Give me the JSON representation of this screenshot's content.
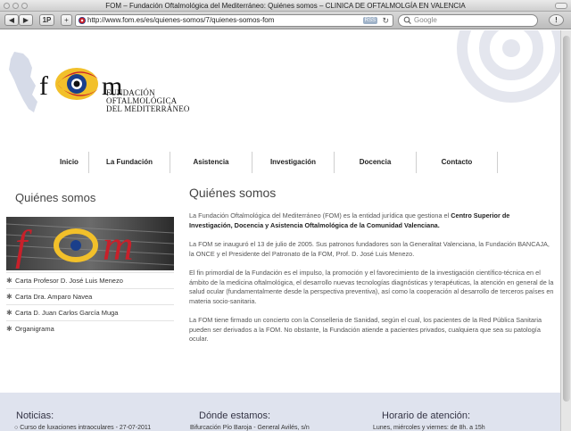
{
  "browser": {
    "window_title": "FOM – Fundación Oftalmológica del Mediterráneo: Quiénes somos – CLINICA DE OFTALMOLGÍA EN VALENCIA",
    "url": "http://www.fom.es/es/quienes-somos/7/quienes-somos-fom",
    "rss_label": "RSS",
    "search_placeholder": "Google",
    "back_label": "◀",
    "forward_label": "▶",
    "one_p_label": "1P",
    "add_label": "+",
    "reload_label": "↻",
    "info_label": "!"
  },
  "logo": {
    "line1": "FUNDACIÓN",
    "line2": "OFTALMOLÓGICA",
    "line3": "DEL MEDITERRÁNEO"
  },
  "nav": [
    {
      "label": "Inicio"
    },
    {
      "label": "La Fundación"
    },
    {
      "label": "Asistencia"
    },
    {
      "label": "Investigación"
    },
    {
      "label": "Docencia"
    },
    {
      "label": "Contacto"
    }
  ],
  "sidebar": {
    "title": "Quiénes somos",
    "items": [
      {
        "label": "Carta Profesor D. José Luis Menezo"
      },
      {
        "label": "Carta Dra. Amparo Navea"
      },
      {
        "label": "Carta D. Juan Carlos García Muga"
      },
      {
        "label": "Organigrama"
      }
    ]
  },
  "main": {
    "title": "Quiénes somos",
    "p1_prefix": "La Fundación Oftalmológica del Mediterráneo (FOM) es la entidad jurídica que gestiona el ",
    "p1_bold": "Centro Superior de Investigación, Docencia y Asistencia Oftalmológica de la Comunidad Valenciana.",
    "p2": "La FOM se inauguró el 13 de julio de 2005. Sus patronos fundadores son la Generalitat Valenciana, la Fundación BANCAJA, la ONCE y el Presidente del Patronato de la FOM, Prof. D. José Luis Menezo.",
    "p3": "El fin primordial de la Fundación es el impulso, la promoción y el favorecimiento de la investigación científico-técnica en el ámbito de la medicina oftalmológica, el desarrollo nuevas tecnologías diagnósticas y terapéuticas, la atención en general de la salud ocular (fundamentalmente desde la perspectiva preventiva), así como la cooperación al desarrollo de terceros países en materia socio-sanitaria.",
    "p4": "La FOM tiene firmado un concierto con la Conselleria de Sanidad, según el cual, los pacientes de la Red Pública Sanitaria pueden ser derivados a la FOM. No obstante, la Fundación atiende a pacientes privados, cualquiera que sea su patología ocular."
  },
  "footer": {
    "news_title": "Noticias:",
    "news_item": "Curso de luxaciones intraoculares - 27-07-2011",
    "location_title": "Dónde estamos:",
    "location_text": "Bifurcación Pío Baroja - General Avilés, s/n",
    "hours_title": "Horario de atención:",
    "hours_text": "Lunes, miércoles y viernes: de 8h. a 15h"
  },
  "colors": {
    "accent_red": "#c8202a",
    "logo_blue": "#1b3f8b",
    "footer_bg": "#dfe3ee"
  }
}
